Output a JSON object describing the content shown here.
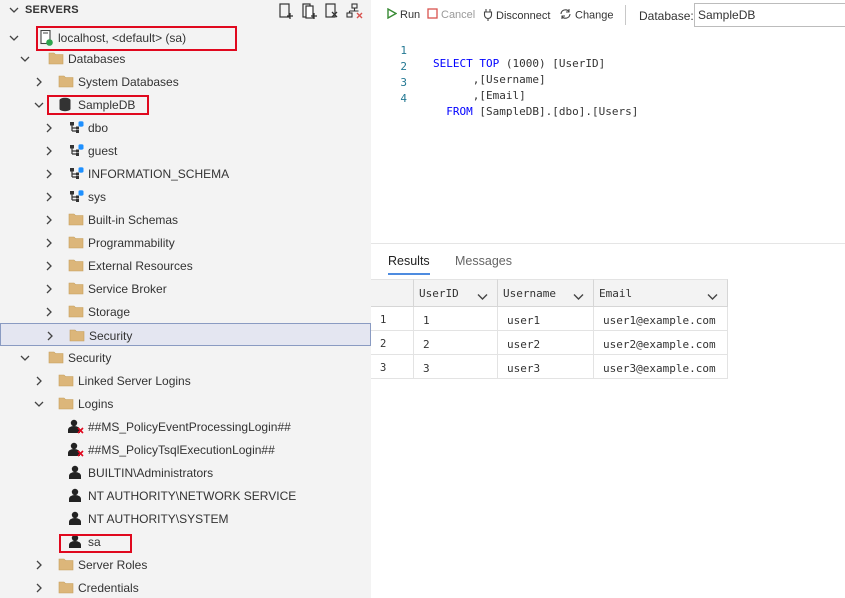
{
  "servers_panel": {
    "title": "SERVERS",
    "tree": [
      {
        "label": "localhost, <default> (sa)",
        "type": "server"
      },
      {
        "label": "Databases",
        "type": "folder"
      },
      {
        "label": "System Databases",
        "type": "folder"
      },
      {
        "label": "SampleDB",
        "type": "database"
      },
      {
        "label": "dbo",
        "type": "schema"
      },
      {
        "label": "guest",
        "type": "schema"
      },
      {
        "label": "INFORMATION_SCHEMA",
        "type": "schema"
      },
      {
        "label": "sys",
        "type": "schema"
      },
      {
        "label": "Built-in Schemas",
        "type": "folder"
      },
      {
        "label": "Programmability",
        "type": "folder"
      },
      {
        "label": "External Resources",
        "type": "folder"
      },
      {
        "label": "Service Broker",
        "type": "folder"
      },
      {
        "label": "Storage",
        "type": "folder"
      },
      {
        "label": "Security",
        "type": "folder"
      },
      {
        "label": "Security",
        "type": "folder"
      },
      {
        "label": "Linked Server Logins",
        "type": "folder"
      },
      {
        "label": "Logins",
        "type": "folder"
      },
      {
        "label": "##MS_PolicyEventProcessingLogin##",
        "type": "login-disabled"
      },
      {
        "label": "##MS_PolicyTsqlExecutionLogin##",
        "type": "login-disabled"
      },
      {
        "label": "BUILTIN\\Administrators",
        "type": "login"
      },
      {
        "label": "NT AUTHORITY\\NETWORK SERVICE",
        "type": "login"
      },
      {
        "label": "NT AUTHORITY\\SYSTEM",
        "type": "login"
      },
      {
        "label": "sa",
        "type": "login"
      },
      {
        "label": "Server Roles",
        "type": "folder"
      },
      {
        "label": "Credentials",
        "type": "folder"
      }
    ]
  },
  "toolbar": {
    "run_label": "Run",
    "cancel_label": "Cancel",
    "disconnect_label": "Disconnect",
    "change_label": "Change",
    "database_label": "Database:",
    "database_value": "SampleDB"
  },
  "editor": {
    "line_numbers": [
      "1",
      "2",
      "3",
      "4"
    ],
    "tokens": {
      "select": "SELECT",
      "top": "TOP",
      "top_value": "(1000)",
      "col_userid": "[UserID]",
      "col_username": ",[Username]",
      "col_email": ",[Email]",
      "from": "FROM",
      "table": "[SampleDB].[dbo].[Users]"
    }
  },
  "results": {
    "tab_results": "Results",
    "tab_messages": "Messages",
    "columns": [
      "UserID",
      "Username",
      "Email"
    ],
    "rows": [
      {
        "rownum": "1",
        "cells": [
          "1",
          "user1",
          "user1@example.com"
        ]
      },
      {
        "rownum": "2",
        "cells": [
          "2",
          "user2",
          "user2@example.com"
        ]
      },
      {
        "rownum": "3",
        "cells": [
          "3",
          "user3",
          "user3@example.com"
        ]
      }
    ]
  },
  "colors": {
    "highlight_box": "#e0081e",
    "keyword": "#0000ff",
    "line_number": "#237893",
    "run_icon": "#388a34",
    "cancel_icon": "#d9534f",
    "folder": "#dcb67a",
    "connected": "#2da44e",
    "selection_bg": "#e4e6f1"
  },
  "icons": {
    "server": "server-connected-icon",
    "folder": "folder-icon",
    "database": "database-icon",
    "schema": "schema-icon",
    "login": "user-icon",
    "login_disabled": "user-disabled-icon"
  }
}
